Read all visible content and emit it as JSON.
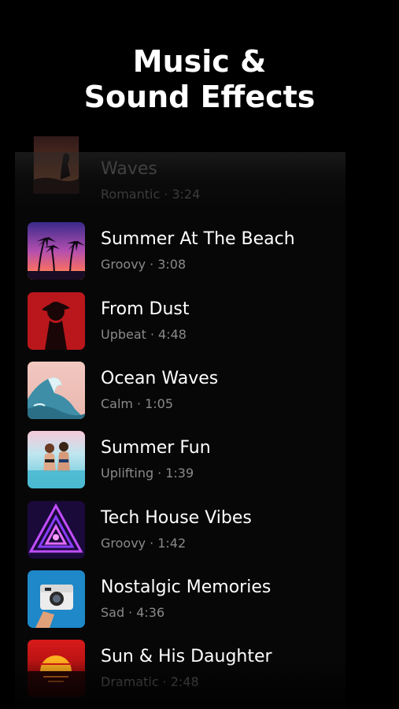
{
  "heading": {
    "line1": "Music &",
    "line2": "Sound Effects"
  },
  "tracks": [
    {
      "title": "Waves",
      "genre": "Romantic",
      "duration": "3:24",
      "art_icon": "sunset-silhouette-art"
    },
    {
      "title": "Summer At The Beach",
      "genre": "Groovy",
      "duration": "3:08",
      "art_icon": "palm-trees-sunset-art"
    },
    {
      "title": "From Dust",
      "genre": "Upbeat",
      "duration": "4:48",
      "art_icon": "red-silhouette-art"
    },
    {
      "title": "Ocean Waves",
      "genre": "Calm",
      "duration": "1:05",
      "art_icon": "ocean-wave-art"
    },
    {
      "title": "Summer Fun",
      "genre": "Uplifting",
      "duration": "1:39",
      "art_icon": "beach-friends-art"
    },
    {
      "title": "Tech House Vibes",
      "genre": "Groovy",
      "duration": "1:42",
      "art_icon": "neon-triangle-art"
    },
    {
      "title": "Nostalgic Memories",
      "genre": "Sad",
      "duration": "4:36",
      "art_icon": "instant-camera-art"
    },
    {
      "title": "Sun & His Daughter",
      "genre": "Dramatic",
      "duration": "2:48",
      "art_icon": "setting-sun-art"
    }
  ],
  "separator": "·",
  "colors": {
    "background": "#000000",
    "title_text": "#ffffff",
    "meta_text": "#8a8a8a"
  }
}
